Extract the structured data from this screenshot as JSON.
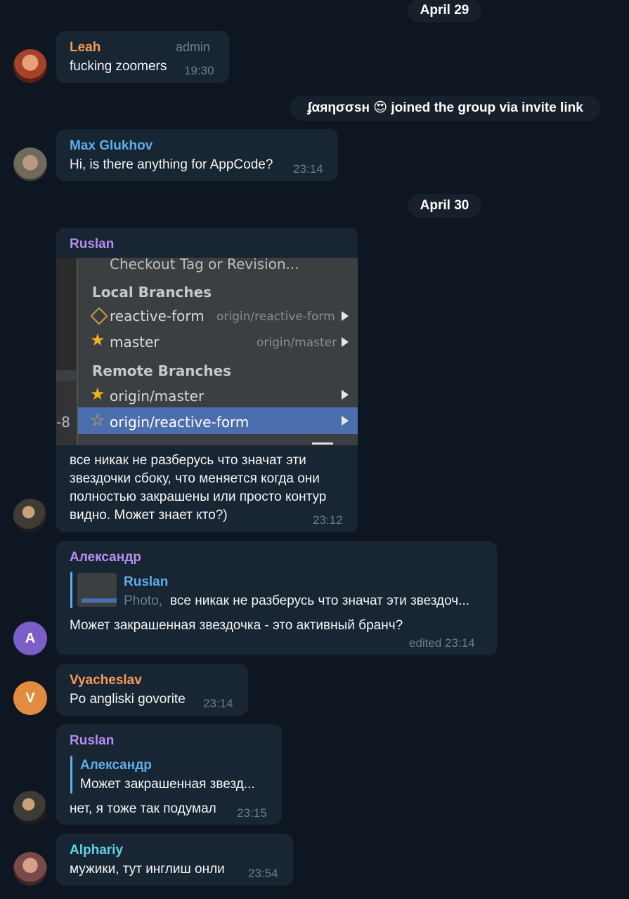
{
  "dates": {
    "d1": "April 29",
    "d2": "April 30"
  },
  "service": {
    "user": "ʄαяησσѕн",
    "emoji": "😍",
    "text": "joined the group via invite link"
  },
  "colors": {
    "background": "#0e1621",
    "bubble": "#182533",
    "accent": "#5eaee8"
  },
  "messages": [
    {
      "sender": "Leah",
      "badge": "admin",
      "text": "fucking zoomers",
      "time": "19:30",
      "name_color": "#f29b58"
    },
    {
      "sender": "Max Glukhov",
      "text": "Hi, is there anything for AppCode?",
      "time": "23:14",
      "name_color": "#5eaee8"
    },
    {
      "sender": "Ruslan",
      "name_color": "#b68ef0",
      "photo": {
        "items": {
          "checkout": "Checkout Tag or Revision...",
          "local_header": "Local Branches",
          "local1": "reactive-form",
          "local1_sub": "origin/reactive-form",
          "local2": "master",
          "local2_sub": "origin/master",
          "remote_header": "Remote Branches",
          "remote1": "origin/master",
          "remote2": "origin/reactive-form",
          "side_label": "-8"
        },
        "icons": [
          "tag-icon",
          "star-filled-icon",
          "star-outline-icon"
        ]
      },
      "lines": [
        "все никак не разберусь что значат эти",
        "звездочки сбоку, что меняется когда они",
        "полностью закрашены или просто контур",
        "видно. Может знает кто?)"
      ],
      "time": "23:12"
    },
    {
      "sender": "Александр",
      "name_color": "#b68ef0",
      "avatar_letter": "A",
      "reply": {
        "name": "Ruslan",
        "prefix": "Photo,",
        "text": "все никак не разберусь что значат эти звездоч..."
      },
      "text": "Может закрашенная звездочка - это активный бранч?",
      "time": "edited 23:14"
    },
    {
      "sender": "Vyacheslav",
      "name_color": "#f29b58",
      "avatar_letter": "V",
      "text": "Po angliski govorite",
      "time": "23:14"
    },
    {
      "sender": "Ruslan",
      "name_color": "#b68ef0",
      "reply": {
        "name": "Александр",
        "text": "Может закрашенная звезд..."
      },
      "text": "нет, я тоже так подумал",
      "time": "23:15"
    },
    {
      "sender": "Alphariy",
      "name_color": "#5ed3e6",
      "text": "мужики, тут инглиш онли",
      "time": "23:54"
    }
  ]
}
